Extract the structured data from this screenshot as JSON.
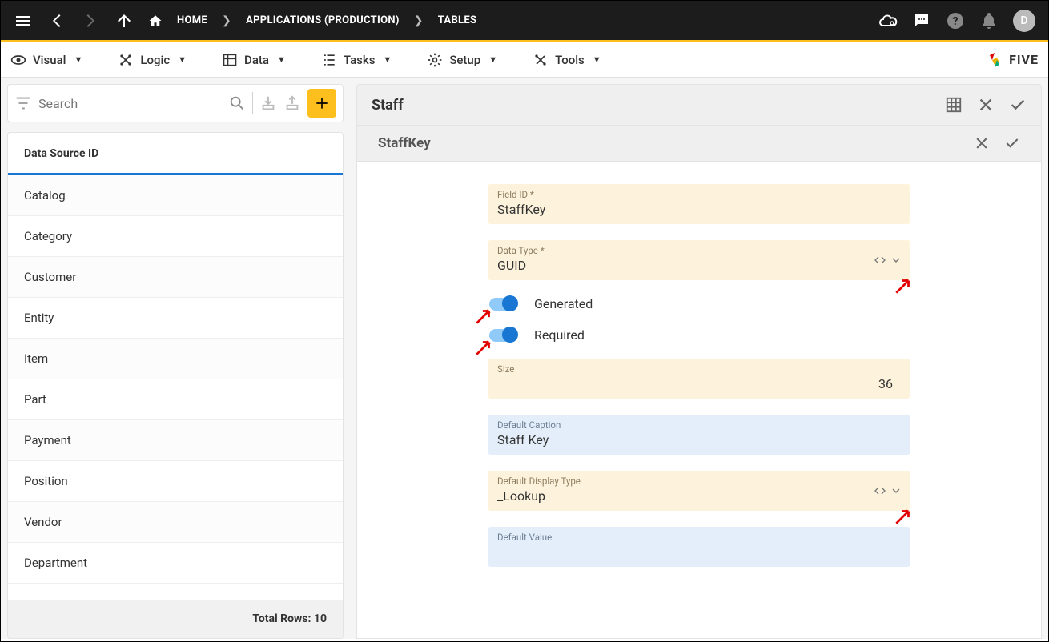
{
  "topbar": {
    "home": "HOME",
    "crumb1": "APPLICATIONS (PRODUCTION)",
    "crumb2": "TABLES",
    "avatar": "D"
  },
  "menu": {
    "visual": "Visual",
    "logic": "Logic",
    "data": "Data",
    "tasks": "Tasks",
    "setup": "Setup",
    "tools": "Tools",
    "logo": "FIVE"
  },
  "sidebar": {
    "searchPlaceholder": "Search",
    "header": "Data Source ID",
    "rows": [
      "Catalog",
      "Category",
      "Customer",
      "Entity",
      "Item",
      "Part",
      "Payment",
      "Position",
      "Vendor",
      "Department"
    ],
    "footer": "Total Rows: 10"
  },
  "main": {
    "title": "Staff",
    "subTitle": "StaffKey",
    "fields": {
      "fieldId": {
        "label": "Field ID *",
        "value": "StaffKey"
      },
      "dataType": {
        "label": "Data Type *",
        "value": "GUID"
      },
      "generated": {
        "label": "Generated",
        "on": true
      },
      "required": {
        "label": "Required",
        "on": true
      },
      "size": {
        "label": "Size",
        "value": "36"
      },
      "caption": {
        "label": "Default Caption",
        "value": "Staff Key"
      },
      "displayType": {
        "label": "Default Display Type",
        "value": "_Lookup"
      },
      "defaultValue": {
        "label": "Default Value",
        "value": ""
      }
    }
  }
}
